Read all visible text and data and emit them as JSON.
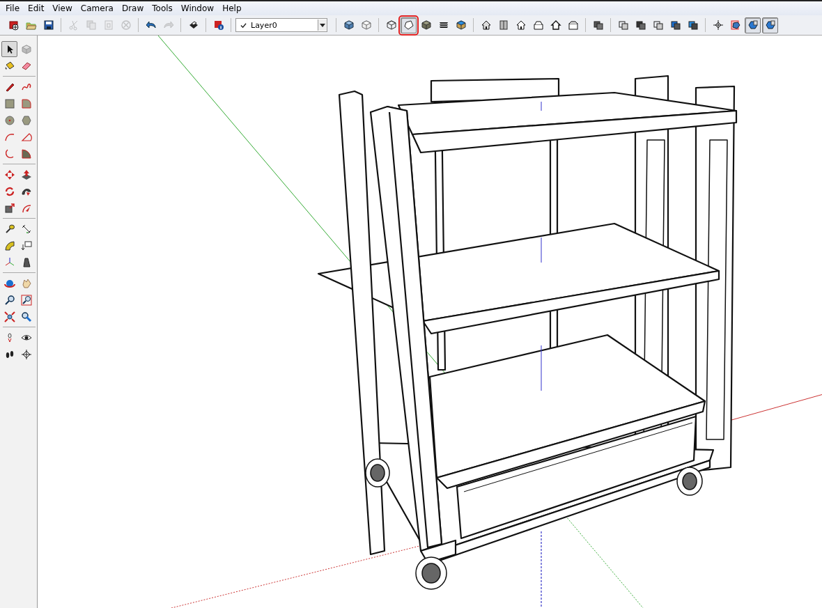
{
  "menu": [
    {
      "label": "File"
    },
    {
      "label": "Edit"
    },
    {
      "label": "View"
    },
    {
      "label": "Camera"
    },
    {
      "label": "Draw"
    },
    {
      "label": "Tools"
    },
    {
      "label": "Window"
    },
    {
      "label": "Help"
    }
  ],
  "toolbar": {
    "groups": [
      [
        {
          "selected": false,
          "disabled": false
        },
        {
          "selected": false,
          "disabled": false
        },
        {
          "selected": false,
          "disabled": false
        }
      ],
      [
        {
          "selected": false,
          "disabled": true
        },
        {
          "selected": false,
          "disabled": true
        },
        {
          "selected": false,
          "disabled": true
        },
        {
          "selected": false,
          "disabled": true
        }
      ],
      [
        {
          "selected": false,
          "disabled": false
        },
        {
          "selected": false,
          "disabled": true
        }
      ],
      [
        {
          "selected": false,
          "disabled": false
        }
      ],
      [
        {
          "selected": false,
          "disabled": false
        }
      ]
    ],
    "layer_dropdown": {
      "value": "Layer0"
    },
    "groups_after": [
      [
        {
          "selected": false,
          "disabled": false
        },
        {
          "selected": false,
          "disabled": false
        }
      ],
      [
        {
          "selected": false,
          "disabled": false
        },
        {
          "selected": true,
          "disabled": false,
          "highlighted": true
        },
        {
          "selected": false,
          "disabled": false
        },
        {
          "selected": false,
          "disabled": false
        },
        {
          "selected": false,
          "disabled": false
        }
      ],
      [
        {
          "selected": false,
          "disabled": false
        },
        {
          "selected": false,
          "disabled": false
        },
        {
          "selected": false,
          "disabled": false
        },
        {
          "selected": false,
          "disabled": false
        },
        {
          "selected": false,
          "disabled": false
        },
        {
          "selected": false,
          "disabled": false
        }
      ],
      [
        {
          "selected": false,
          "disabled": false
        }
      ],
      [
        {
          "selected": false,
          "disabled": false
        },
        {
          "selected": false,
          "disabled": false
        },
        {
          "selected": false,
          "disabled": false
        },
        {
          "selected": false,
          "disabled": false
        },
        {
          "selected": false,
          "disabled": false
        }
      ],
      [
        {
          "selected": false,
          "disabled": false
        },
        {
          "selected": false,
          "disabled": false
        },
        {
          "selected": true,
          "disabled": false
        },
        {
          "selected": true,
          "disabled": false
        }
      ]
    ]
  },
  "tool_palette": {
    "groups": [
      [
        {
          "selected": true
        },
        {
          "selected": false
        },
        {
          "selected": false
        },
        {
          "selected": false
        }
      ],
      [
        {
          "selected": false
        },
        {
          "selected": false
        },
        {
          "selected": false
        },
        {
          "selected": false
        },
        {
          "selected": false
        },
        {
          "selected": false
        },
        {
          "selected": false
        },
        {
          "selected": false
        },
        {
          "selected": false
        },
        {
          "selected": false
        }
      ],
      [
        {
          "selected": false
        },
        {
          "selected": false
        },
        {
          "selected": false
        },
        {
          "selected": false
        },
        {
          "selected": false
        },
        {
          "selected": false
        }
      ],
      [
        {
          "selected": false
        },
        {
          "selected": false
        },
        {
          "selected": false
        },
        {
          "selected": false
        },
        {
          "selected": false
        },
        {
          "selected": false
        }
      ],
      [
        {
          "selected": false
        },
        {
          "selected": false
        },
        {
          "selected": false
        },
        {
          "selected": false
        },
        {
          "selected": false
        },
        {
          "selected": false
        }
      ],
      [
        {
          "selected": false
        },
        {
          "selected": false
        },
        {
          "selected": false
        },
        {
          "selected": false
        }
      ]
    ]
  }
}
